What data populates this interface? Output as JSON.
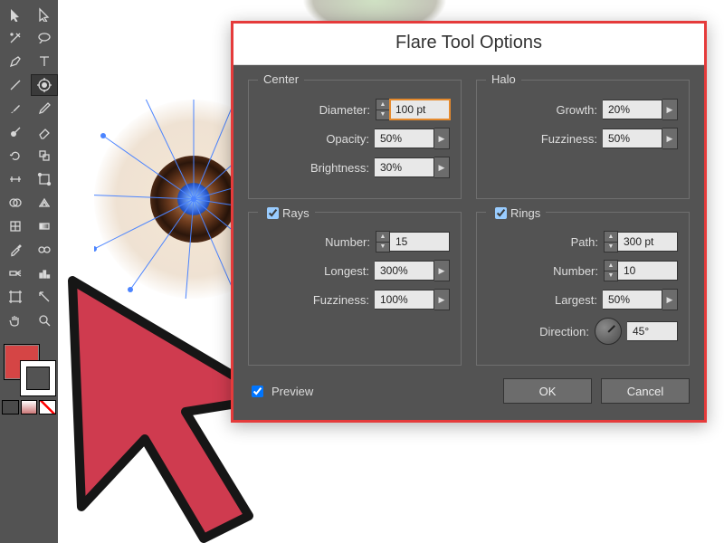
{
  "dialog": {
    "title": "Flare Tool Options",
    "center": {
      "legend": "Center",
      "diameter_label": "Diameter:",
      "diameter": "100 pt",
      "opacity_label": "Opacity:",
      "opacity": "50%",
      "brightness_label": "Brightness:",
      "brightness": "30%"
    },
    "halo": {
      "legend": "Halo",
      "growth_label": "Growth:",
      "growth": "20%",
      "fuzziness_label": "Fuzziness:",
      "fuzziness": "50%"
    },
    "rays": {
      "legend": "Rays",
      "checked": true,
      "number_label": "Number:",
      "number": "15",
      "longest_label": "Longest:",
      "longest": "300%",
      "fuzziness_label": "Fuzziness:",
      "fuzziness": "100%"
    },
    "rings": {
      "legend": "Rings",
      "checked": true,
      "path_label": "Path:",
      "path": "300 pt",
      "number_label": "Number:",
      "number": "10",
      "largest_label": "Largest:",
      "largest": "50%",
      "direction_label": "Direction:",
      "direction": "45°"
    },
    "preview_label": "Preview",
    "preview_checked": true,
    "ok": "OK",
    "cancel": "Cancel"
  },
  "toolbox": {
    "tools": [
      "selection",
      "direct-selection",
      "magic-wand",
      "lasso",
      "pen",
      "type",
      "line-segment",
      "flare",
      "paintbrush",
      "pencil",
      "blob-brush",
      "eraser",
      "rotate",
      "scale",
      "width",
      "free-transform",
      "shape-builder",
      "perspective-grid",
      "mesh",
      "gradient",
      "eyedropper",
      "blend",
      "symbol-sprayer",
      "column-graph",
      "artboard",
      "slice",
      "hand",
      "zoom"
    ],
    "selected": "flare"
  }
}
